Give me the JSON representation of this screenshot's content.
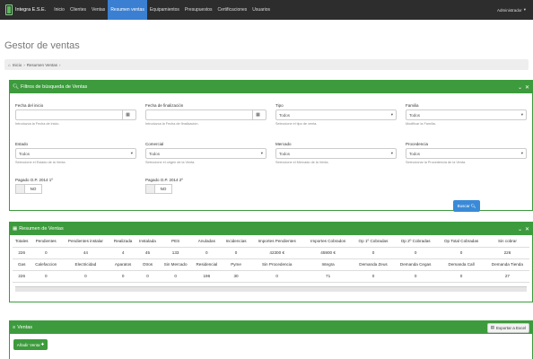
{
  "brand": {
    "name": "Integra E.S.E."
  },
  "nav": {
    "items": [
      "Inicio",
      "Clientes",
      "Ventas",
      "Resumen ventas",
      "Equipamientos",
      "Presupuestos",
      "Certificaciones",
      "Usuarios"
    ],
    "active_index": 3,
    "user": "Administrador"
  },
  "page": {
    "title": "Gestor de ventas"
  },
  "breadcrumb": {
    "home": "Inicio",
    "sep": "›",
    "current": "Resumen Ventas"
  },
  "filters": {
    "title": "Filtros de búsqueda de Ventas",
    "fecha_inicio": {
      "label": "Fecha del inicio",
      "value": "",
      "help": "Introduzca la Fecha de inicio."
    },
    "fecha_fin": {
      "label": "Fecha de finalización",
      "value": "",
      "help": "Introduzca la Fecha de finalización."
    },
    "tipo": {
      "label": "Tipo",
      "value": "Todos",
      "help": "Seleccione el tipo de venta."
    },
    "familia": {
      "label": "Familia",
      "value": "Todos",
      "help": "Modificar la Familia."
    },
    "estado": {
      "label": "Estado",
      "value": "Todos",
      "help": "Seleccione el Estado de la Venta."
    },
    "comercial": {
      "label": "Comercial",
      "value": "Todos",
      "help": "Seleccione el origen de la Venta."
    },
    "mercado": {
      "label": "Mercado",
      "value": "Todos",
      "help": "Seleccione el Mercado de la Venta."
    },
    "procedencia": {
      "label": "Procedencia",
      "value": "Todos",
      "help": "Seleccionar la Procedencia de la Venta."
    },
    "pagado1": {
      "label": "Pagado O.P. 2014 1º",
      "value": "NO"
    },
    "pagado2": {
      "label": "Pagado O.P. 2014 2º",
      "value": "NO"
    },
    "search_button": "Buscar"
  },
  "summary": {
    "title": "Resumen de Ventas",
    "row1_headers": [
      "Totales",
      "Pendientes",
      "Pendientes instalar",
      "Realizada",
      "Instalada",
      "PES",
      "Anuladas",
      "Incidencias",
      "Importes Pendientes",
      "Importes Cobrados",
      "Op 1º Cobradas",
      "Op 2º Cobradas",
      "Op Total Cobradas",
      "Sin cobrar"
    ],
    "row1_values": [
      "226",
      "0",
      "44",
      "4",
      "45",
      "133",
      "0",
      "0",
      "42300 €",
      "45900 €",
      "0",
      "0",
      "0",
      "226"
    ],
    "row2_headers": [
      "Gas",
      "Calefaccion",
      "Electricidad",
      "Aparatos",
      "Otros",
      "Sin Mercado",
      "Residencial",
      "Pyme",
      "Sin Procedencia",
      "Integra",
      "Demanda Zeus",
      "Demanda Cegas",
      "Demanda Call",
      "Demanda Tienda"
    ],
    "row2_values": [
      "226",
      "0",
      "0",
      "0",
      "0",
      "0",
      "196",
      "30",
      "0",
      "71",
      "0",
      "0",
      "0",
      "27"
    ]
  },
  "ventas": {
    "title": "Ventas",
    "export_button": "Exportar a Excel",
    "add_button": "Añadir Venta"
  },
  "colors": {
    "panel_green": "#3d9b3d",
    "nav_dark": "#2d2d2d",
    "nav_active": "#3a7fd1",
    "button_blue": "#3a8ad8"
  }
}
